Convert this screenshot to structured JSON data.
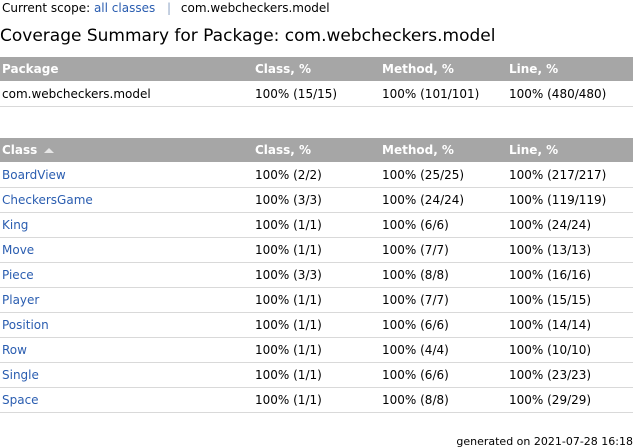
{
  "breadcrumb": {
    "label": "Current scope:",
    "all_classes": "all classes",
    "separator": "|",
    "current": "com.webcheckers.model"
  },
  "title": "Coverage Summary for Package: com.webcheckers.model",
  "package_table": {
    "headers": [
      "Package",
      "Class, %",
      "Method, %",
      "Line, %"
    ],
    "rows": [
      {
        "name": "com.webcheckers.model",
        "class": "100% (15/15)",
        "method": "100% (101/101)",
        "line": "100% (480/480)"
      }
    ]
  },
  "class_table": {
    "headers": [
      "Class",
      "Class, %",
      "Method, %",
      "Line, %"
    ],
    "rows": [
      {
        "name": "BoardView",
        "class": "100% (2/2)",
        "method": "100% (25/25)",
        "line": "100% (217/217)"
      },
      {
        "name": "CheckersGame",
        "class": "100% (3/3)",
        "method": "100% (24/24)",
        "line": "100% (119/119)"
      },
      {
        "name": "King",
        "class": "100% (1/1)",
        "method": "100% (6/6)",
        "line": "100% (24/24)"
      },
      {
        "name": "Move",
        "class": "100% (1/1)",
        "method": "100% (7/7)",
        "line": "100% (13/13)"
      },
      {
        "name": "Piece",
        "class": "100% (3/3)",
        "method": "100% (8/8)",
        "line": "100% (16/16)"
      },
      {
        "name": "Player",
        "class": "100% (1/1)",
        "method": "100% (7/7)",
        "line": "100% (15/15)"
      },
      {
        "name": "Position",
        "class": "100% (1/1)",
        "method": "100% (6/6)",
        "line": "100% (14/14)"
      },
      {
        "name": "Row",
        "class": "100% (1/1)",
        "method": "100% (4/4)",
        "line": "100% (10/10)"
      },
      {
        "name": "Single",
        "class": "100% (1/1)",
        "method": "100% (6/6)",
        "line": "100% (23/23)"
      },
      {
        "name": "Space",
        "class": "100% (1/1)",
        "method": "100% (8/8)",
        "line": "100% (29/29)"
      }
    ]
  },
  "footer": "generated on 2021-07-28 16:18",
  "colors": {
    "header_bg": "#a6a6a6",
    "link": "#2a5db0",
    "row_border": "#d9d9d9"
  }
}
